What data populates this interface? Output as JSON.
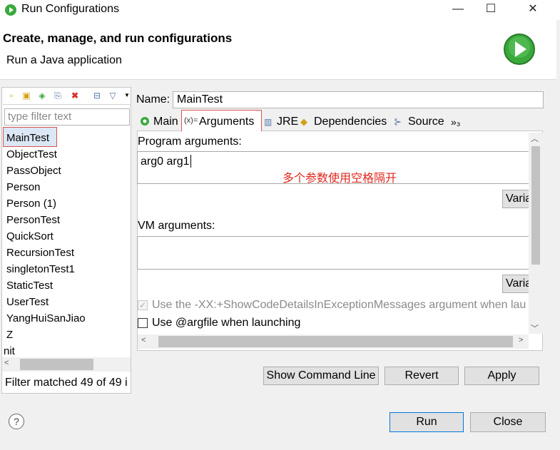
{
  "window": {
    "title": "Run Configurations",
    "minimize": "—",
    "maximize": "☐",
    "close": "✕"
  },
  "header": {
    "title": "Create, manage, and run configurations",
    "subtitle": "Run a Java application"
  },
  "sidebar": {
    "filter_placeholder": "type filter text",
    "items": [
      "MainTest",
      "ObjectTest",
      "PassObject",
      "Person",
      "Person (1)",
      "PersonTest",
      "QuickSort",
      "RecursionTest",
      "singletonTest1",
      "StaticTest",
      "UserTest",
      "YangHuiSanJiao",
      "Z",
      "nit"
    ],
    "selected": "MainTest",
    "status": "Filter matched 49 of 49 i"
  },
  "config": {
    "name_label": "Name:",
    "name_value": "MainTest",
    "tabs": [
      "Main",
      "Arguments",
      "JRE",
      "Dependencies",
      "Source",
      "»₃"
    ],
    "active_tab": "Arguments",
    "program_args_label": "Program arguments:",
    "program_args_value": "arg0 arg1",
    "annotation": "多个参数使用空格隔开",
    "variables_label": "Varia",
    "vm_args_label": "VM arguments:",
    "vm_args_value": "",
    "show_details_label": "Use the -XX:+ShowCodeDetailsInExceptionMessages argument when lau",
    "argfile_label": "Use @argfile when launching",
    "show_cmd": "Show Command Line",
    "revert": "Revert",
    "apply": "Apply"
  },
  "footer": {
    "help": "?",
    "run": "Run",
    "close": "Close"
  },
  "colors": {
    "annotation": "#e0281e",
    "highlight_border": "#d9534f",
    "run_icon": "#3aa83a"
  }
}
